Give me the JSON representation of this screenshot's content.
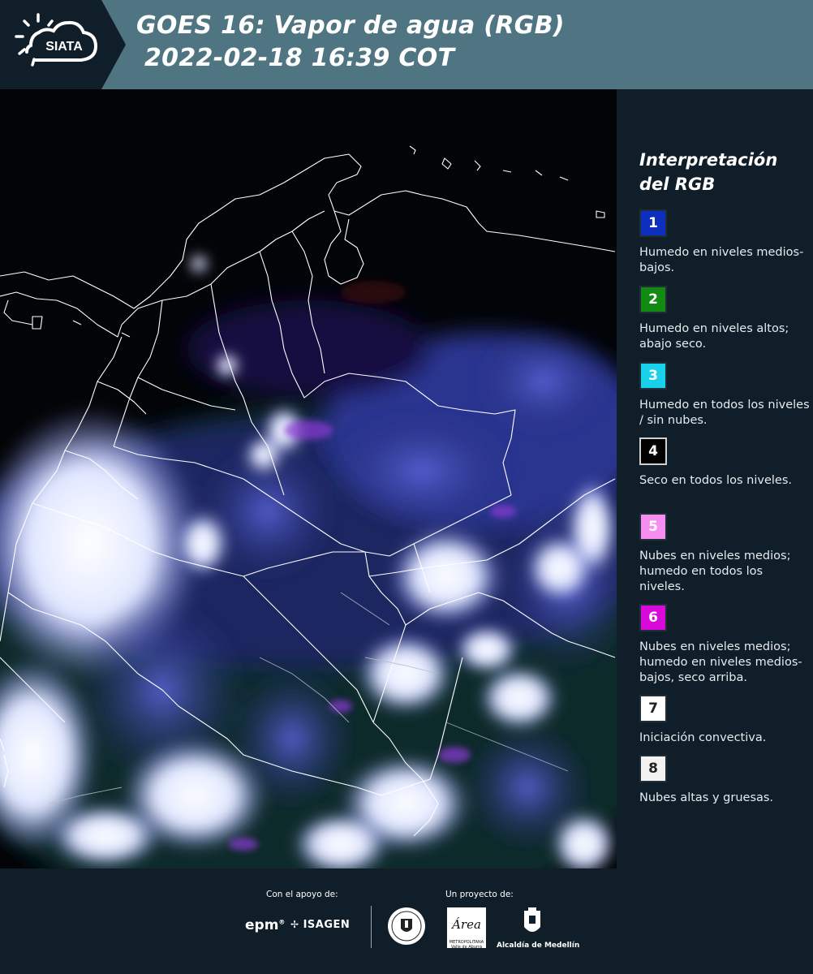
{
  "header": {
    "logo_text": "SIATA",
    "title_line1": "GOES 16: Vapor de agua (RGB)",
    "title_line2": "2022-02-18 16:39 COT",
    "background_color": "#4f7482"
  },
  "legend": {
    "title_line1": "Interpretación",
    "title_line2": "del RGB",
    "items": [
      {
        "number": "1",
        "color": "#0d2fbf",
        "text": "Humedo en niveles medios-bajos."
      },
      {
        "number": "2",
        "color": "#128a12",
        "text": "Humedo en niveles altos; abajo seco."
      },
      {
        "number": "3",
        "color": "#19d1ea",
        "text": "Humedo en todos los niveles / sin nubes."
      },
      {
        "number": "4",
        "color": "#000000",
        "text": "Seco en todos los niveles."
      },
      {
        "number": "5",
        "color": "#f58ef0",
        "text": "Nubes en niveles medios; humedo en todos los niveles."
      },
      {
        "number": "6",
        "color": "#d90ad9",
        "text": "Nubes en niveles medios; humedo en niveles medios-bajos, seco arriba."
      },
      {
        "number": "7",
        "color": "#ffffff",
        "text": "Iniciación convectiva."
      },
      {
        "number": "8",
        "color": "#f2f2f2",
        "text": "Nubes altas y gruesas."
      }
    ]
  },
  "footer": {
    "support_label": "Con el apoyo de:",
    "project_label": "Un proyecto de:",
    "sponsor_1": "epm",
    "sponsor_2": "ISAGEN",
    "partner_1_text": "Área",
    "partner_1_subtext": "METROPOLITANA Valle de Aburrá",
    "partner_2": "Alcaldía de Medellín"
  }
}
